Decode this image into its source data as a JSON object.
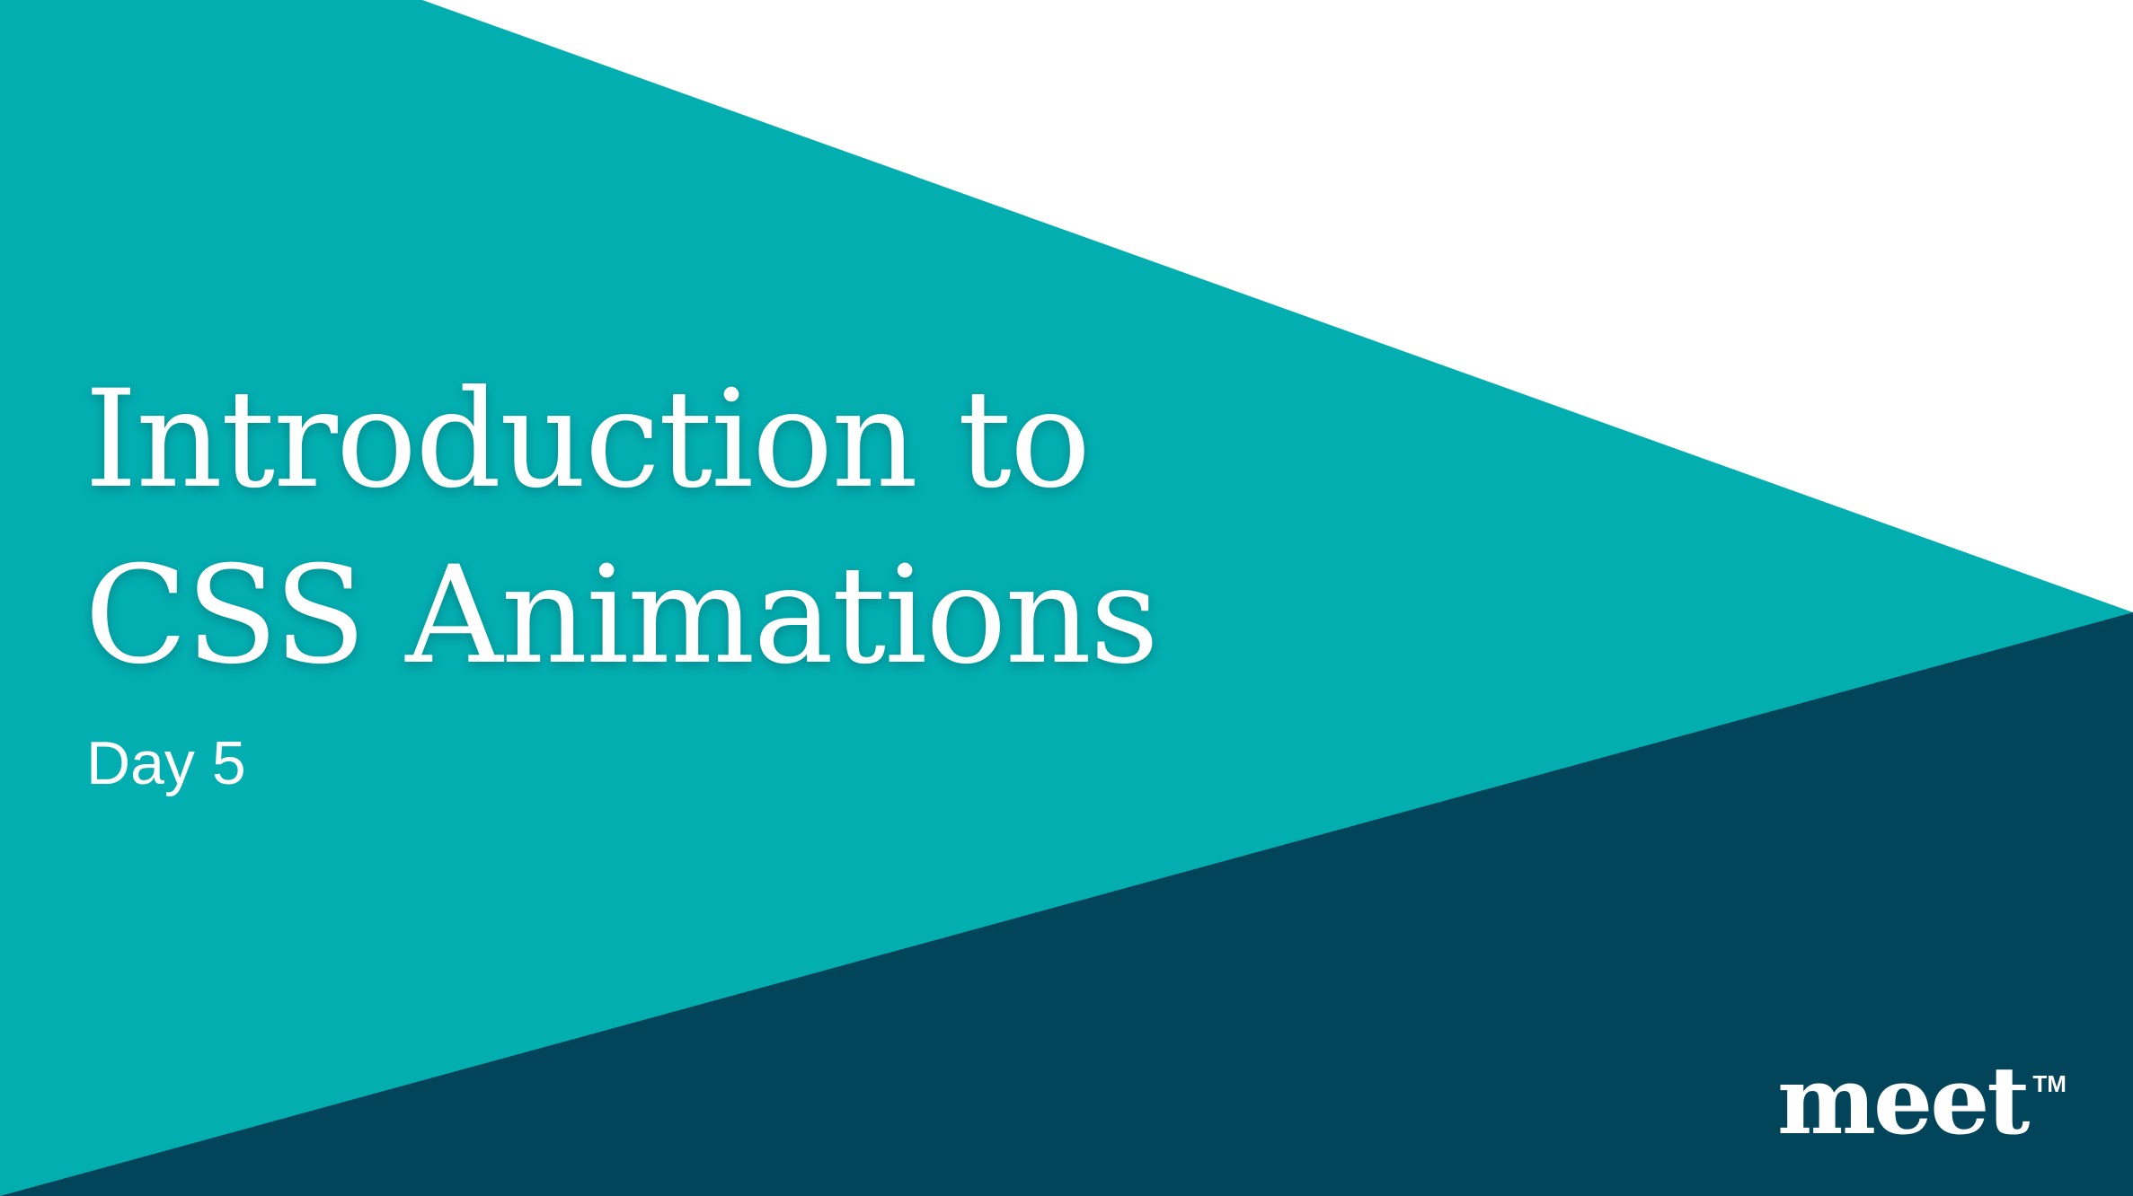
{
  "slide": {
    "title_line1": "Introduction to",
    "title_line2": "CSS Animations",
    "subtitle": "Day 5"
  },
  "logo": {
    "word": "meet",
    "trademark": "TM"
  },
  "colors": {
    "teal": "#03aeb1",
    "navy": "#02445a",
    "white": "#ffffff"
  }
}
